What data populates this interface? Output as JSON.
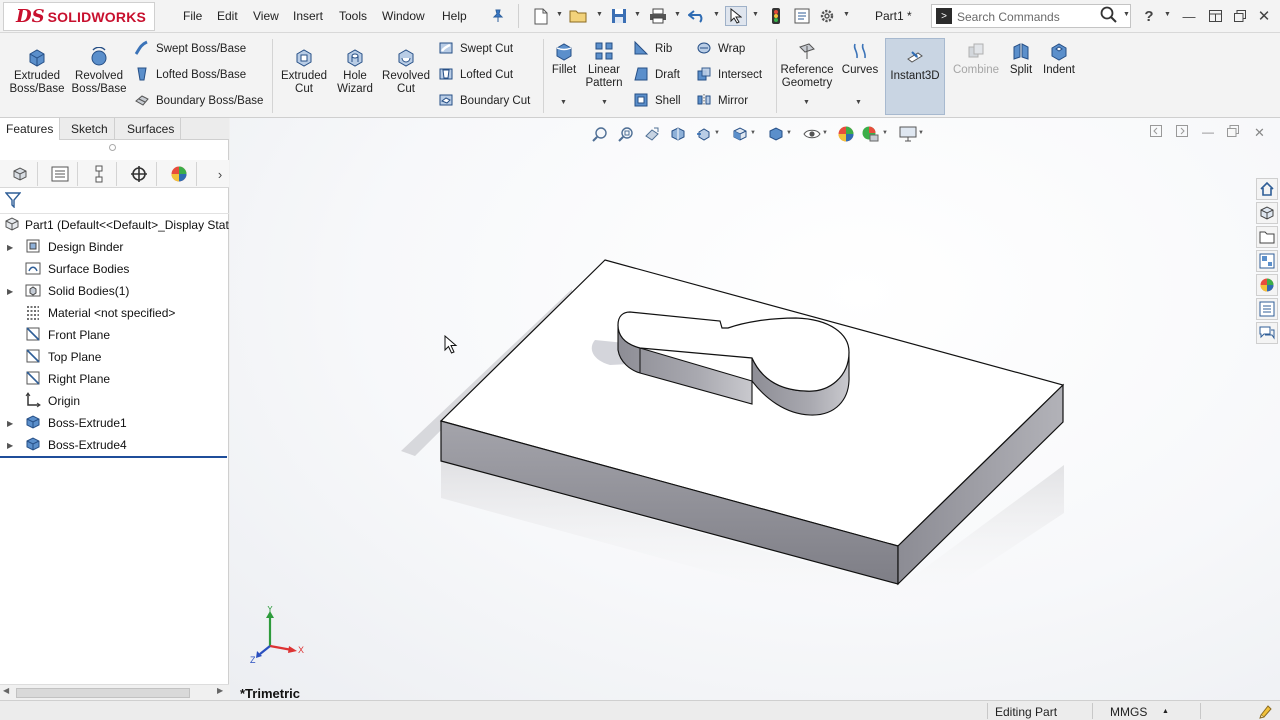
{
  "app": {
    "logo_ds": "DS",
    "logo_text": "SOLIDWORKS",
    "document_title": "Part1 *"
  },
  "menu": [
    "File",
    "Edit",
    "View",
    "Insert",
    "Tools",
    "Window",
    "Help"
  ],
  "search": {
    "placeholder": "Search Commands"
  },
  "ribbon": {
    "extruded_boss": [
      "Extruded",
      "Boss/Base"
    ],
    "revolved_boss": [
      "Revolved",
      "Boss/Base"
    ],
    "swept_boss": "Swept Boss/Base",
    "lofted_boss": "Lofted Boss/Base",
    "boundary_boss": "Boundary Boss/Base",
    "extruded_cut": [
      "Extruded",
      "Cut"
    ],
    "hole_wizard": [
      "Hole",
      "Wizard"
    ],
    "revolved_cut": [
      "Revolved",
      "Cut"
    ],
    "swept_cut": "Swept Cut",
    "lofted_cut": "Lofted Cut",
    "boundary_cut": "Boundary Cut",
    "fillet": "Fillet",
    "linear_pattern": [
      "Linear",
      "Pattern"
    ],
    "rib": "Rib",
    "draft": "Draft",
    "shell": "Shell",
    "wrap": "Wrap",
    "intersect": "Intersect",
    "mirror": "Mirror",
    "reference_geometry": [
      "Reference",
      "Geometry"
    ],
    "curves": "Curves",
    "instant3d": "Instant3D",
    "combine": "Combine",
    "split": "Split",
    "indent": "Indent"
  },
  "command_tabs": [
    "Features",
    "Sketch",
    "Surfaces"
  ],
  "feature_tree": {
    "root": "Part1  (Default<<Default>_Display Stat",
    "items": [
      {
        "label": "Design Binder",
        "expandable": true,
        "icon": "binder-icon"
      },
      {
        "label": "Surface Bodies",
        "expandable": false,
        "icon": "surface-bodies-icon"
      },
      {
        "label": "Solid Bodies(1)",
        "expandable": true,
        "icon": "solid-bodies-icon"
      },
      {
        "label": "Material <not specified>",
        "expandable": false,
        "icon": "material-icon"
      },
      {
        "label": "Front Plane",
        "expandable": false,
        "icon": "plane-icon"
      },
      {
        "label": "Top Plane",
        "expandable": false,
        "icon": "plane-icon"
      },
      {
        "label": "Right Plane",
        "expandable": false,
        "icon": "plane-icon"
      },
      {
        "label": "Origin",
        "expandable": false,
        "icon": "origin-icon"
      },
      {
        "label": "Boss-Extrude1",
        "expandable": true,
        "icon": "extrude-icon"
      },
      {
        "label": "Boss-Extrude4",
        "expandable": true,
        "icon": "extrude-icon"
      }
    ]
  },
  "viewport": {
    "view_name": "*Trimetric",
    "triad": {
      "x": "X",
      "y": "Y",
      "z": "Z"
    }
  },
  "status": {
    "mode": "Editing Part",
    "units": "MMGS"
  },
  "colors": {
    "brand_red": "#c8102e",
    "accent_blue": "#2f5e97",
    "instant3d_active": "#c9d5e3",
    "model_face_top": "#ffffff",
    "model_face_side": "#8a8a92"
  }
}
